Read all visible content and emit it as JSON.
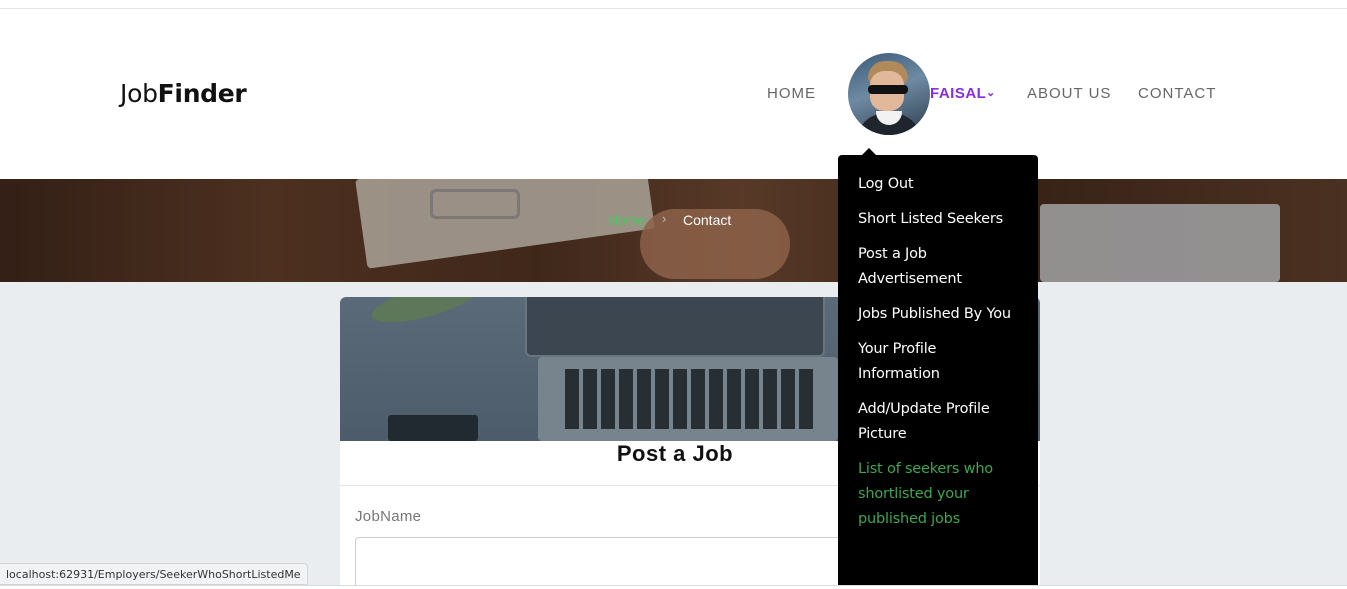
{
  "brand": {
    "logo_light": "Job",
    "logo_bold": "Finder"
  },
  "nav": {
    "home": "HOME",
    "user_name": "FAISAL",
    "about": "ABOUT US",
    "contact": "CONTACT"
  },
  "breadcrumb": {
    "home": "Home",
    "separator": "›",
    "current": "Contact"
  },
  "dropdown": {
    "items": [
      "Log Out",
      "Short Listed Seekers",
      "Post a Job Advertisement",
      "Jobs Published By You",
      "Your Profile Information",
      "Add/Update Profile Picture",
      "List of seekers who shortlisted your published jobs"
    ],
    "active_color": "#3aa84e"
  },
  "form": {
    "title": "Post a Job",
    "job_name_label": "JobName",
    "job_name_value": ""
  },
  "status_bar": {
    "url": "localhost:62931/Employers/SeekerWhoShortListedMe"
  },
  "colors": {
    "accent_purple": "#8b2be2",
    "accent_green": "#3ecf5a"
  }
}
